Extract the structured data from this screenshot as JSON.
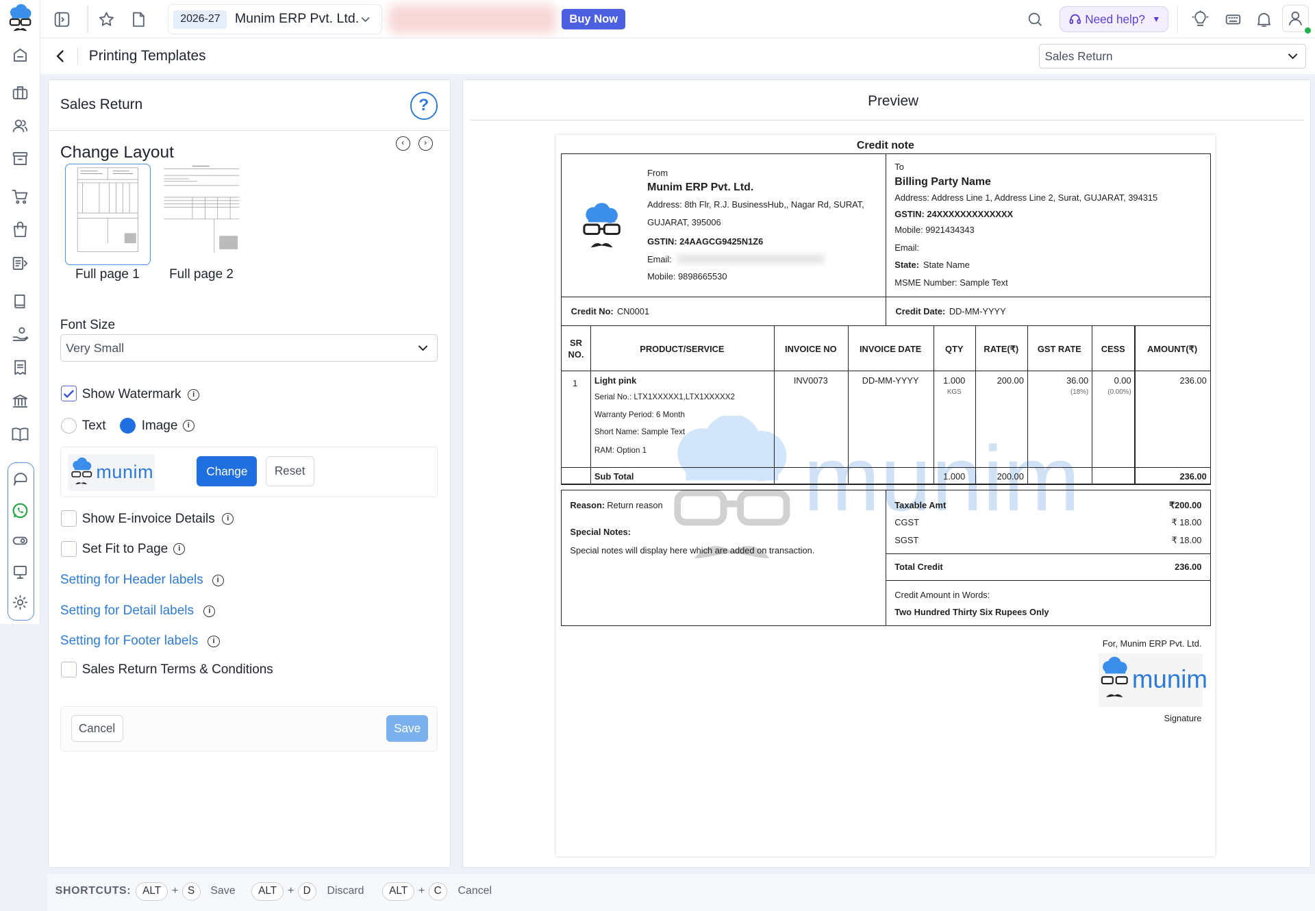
{
  "topbar": {
    "fy": "2026-27",
    "company": "Munim ERP Pvt. Ltd.",
    "buy_now": "Buy Now",
    "need_help": "Need help?"
  },
  "header": {
    "title": "Printing Templates",
    "doc_type": "Sales Return"
  },
  "settings": {
    "title": "Sales Return",
    "change_layout": "Change Layout",
    "layouts": [
      "Full page 1",
      "Full page 2"
    ],
    "font_size_label": "Font Size",
    "font_size_value": "Very Small",
    "show_watermark": "Show Watermark",
    "wm_text": "Text",
    "wm_image": "Image",
    "change_btn": "Change",
    "reset_btn": "Reset",
    "logo_text": "munim",
    "show_einvoice": "Show E-invoice Details",
    "fit_page": "Set Fit to Page",
    "header_labels": "Setting for Header labels",
    "detail_labels": "Setting for Detail labels",
    "footer_labels": "Setting for Footer labels",
    "terms": "Sales Return Terms & Conditions",
    "cancel": "Cancel",
    "save": "Save"
  },
  "preview": {
    "title": "Preview",
    "doc_title": "Credit note",
    "from": {
      "label": "From",
      "name": "Munim ERP Pvt. Ltd.",
      "address1": "Address: 8th Flr, R.J. BusinessHub,, Nagar Rd, SURAT,",
      "address2": "GUJARAT, 395006",
      "gstin": "GSTIN: 24AAGCG9425N1Z6",
      "email": "Email:",
      "mobile": "Mobile: 9898665530"
    },
    "to": {
      "label": "To",
      "name": "Billing Party Name",
      "address": "Address: Address Line 1, Address Line 2, Surat, GUJARAT, 394315",
      "gstin": "GSTIN: 24XXXXXXXXXXXXX",
      "mobile": "Mobile: 9921434343",
      "email": "Email:",
      "state_label": "State:",
      "state_value": "State Name",
      "msme": "MSME Number: Sample Text"
    },
    "credit_no_label": "Credit No:",
    "credit_no": "CN0001",
    "credit_date_label": "Credit Date:",
    "credit_date": "DD-MM-YYYY",
    "columns": [
      "SR NO.",
      "PRODUCT/SERVICE",
      "INVOICE NO",
      "INVOICE DATE",
      "QTY",
      "RATE(₹)",
      "GST RATE",
      "CESS",
      "AMOUNT(₹)"
    ],
    "row": {
      "sr": "1",
      "product": "Light pink",
      "serial": "Serial No.: LTX1XXXXX1,LTX1XXXXX2",
      "warranty": "Warranty Period: 6 Month",
      "short_name": "Short Name: Sample Text",
      "ram": "RAM: Option 1",
      "invoice_no": "INV0073",
      "invoice_date": "DD-MM-YYYY",
      "qty": "1.000",
      "unit": "KGS",
      "rate": "200.00",
      "gst": "36.00",
      "gst_pct": "(18%)",
      "cess": "0.00",
      "cess_pct": "(0.00%)",
      "amount": "236.00"
    },
    "subtotal": {
      "label": "Sub Total",
      "qty": "1.000",
      "rate": "200.00",
      "amount": "236.00"
    },
    "reason_label": "Reason:",
    "reason": "Return reason",
    "special_notes_label": "Special Notes:",
    "special_notes": "Special notes will display here which are added on transaction.",
    "taxable_label": "Taxable Amt",
    "taxable": "₹200.00",
    "cgst_label": "CGST",
    "cgst": "₹ 18.00",
    "sgst_label": "SGST",
    "sgst": "₹ 18.00",
    "total_label": "Total Credit",
    "total": "236.00",
    "words_label": "Credit Amount in Words:",
    "words": "Two Hundred Thirty Six Rupees Only",
    "for_company": "For, Munim ERP Pvt. Ltd.",
    "signature": "Signature",
    "sig_logo_text": "munim",
    "watermark_text": "munim"
  },
  "shortcuts": {
    "label": "SHORTCUTS:",
    "alt": "ALT",
    "plus": "+",
    "items": [
      {
        "key": "S",
        "action": "Save"
      },
      {
        "key": "D",
        "action": "Discard"
      },
      {
        "key": "C",
        "action": "Cancel"
      }
    ]
  },
  "colors": {
    "primary": "#1f6fe0",
    "link": "#2e7ad8",
    "buy_now": "#4b5fe0",
    "logo_blue": "#3b8eea"
  }
}
